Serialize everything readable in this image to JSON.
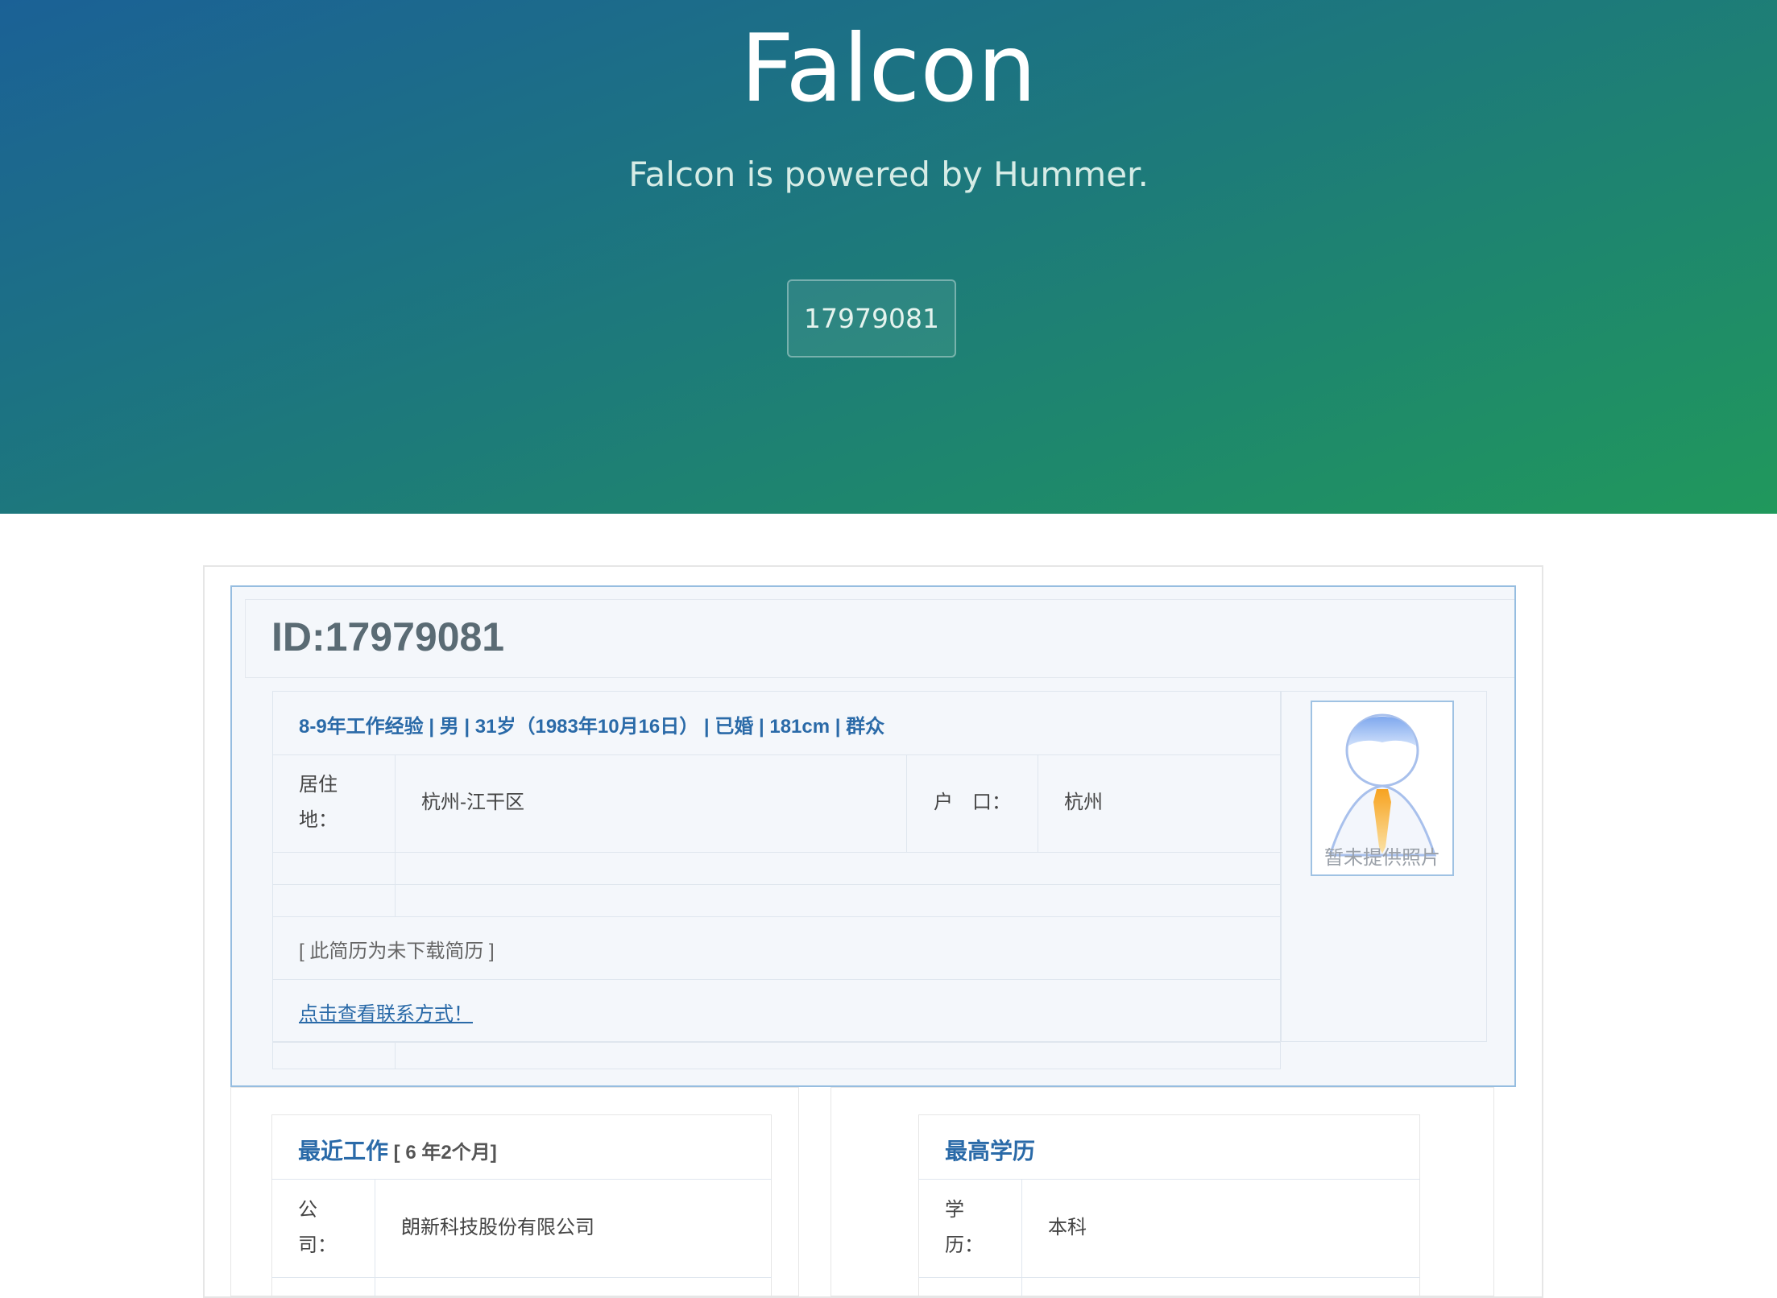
{
  "hero": {
    "title": "Falcon",
    "subtitle": "Falcon is powered by Hummer.",
    "id_button": "17979081"
  },
  "resume": {
    "id_label": "ID:17979081",
    "summary": "8-9年工作经验 | 男 |  31岁（1983年10月16日） |  已婚 |  181cm |  群众",
    "residence_label": "居住地：",
    "residence_value": "杭州-江干区",
    "hukou_label": "户　口：",
    "hukou_value": "杭州",
    "note": "[ 此简历为未下载简历 ]",
    "contact_link": "点击查看联系方式！",
    "photo_caption": "暂未提供照片"
  },
  "recent_work": {
    "title": "最近工作",
    "duration": " [ 6 年2个月]",
    "company_label": "公司：",
    "company_value": "朗新科技股份有限公司"
  },
  "education": {
    "title": "最高学历",
    "degree_label": "学历：",
    "degree_value": "本科"
  },
  "colors": {
    "hero_start": "#1b6196",
    "hero_end": "#20985c",
    "link": "#2a6aa8"
  }
}
